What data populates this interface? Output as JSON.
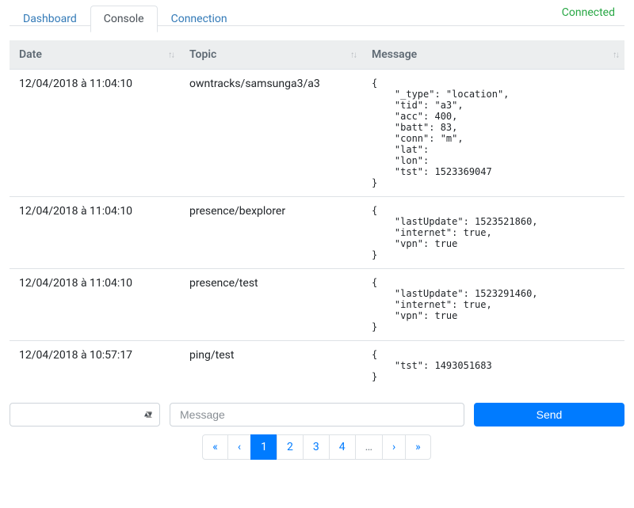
{
  "tabs": [
    {
      "label": "Dashboard",
      "active": false
    },
    {
      "label": "Console",
      "active": true
    },
    {
      "label": "Connection",
      "active": false
    }
  ],
  "status": "Connected",
  "columns": {
    "date": "Date",
    "topic": "Topic",
    "message": "Message"
  },
  "rows": [
    {
      "date": "12/04/2018 à 11:04:10",
      "topic": "owntracks/samsunga3/a3",
      "message": "{\n    \"_type\": \"location\",\n    \"tid\": \"a3\",\n    \"acc\": 400,\n    \"batt\": 83,\n    \"conn\": \"m\",\n    \"lat\":\n    \"lon\":\n    \"tst\": 1523369047\n}"
    },
    {
      "date": "12/04/2018 à 11:04:10",
      "topic": "presence/bexplorer",
      "message": "{\n    \"lastUpdate\": 1523521860,\n    \"internet\": true,\n    \"vpn\": true\n}"
    },
    {
      "date": "12/04/2018 à 11:04:10",
      "topic": "presence/test",
      "message": "{\n    \"lastUpdate\": 1523291460,\n    \"internet\": true,\n    \"vpn\": true\n}"
    },
    {
      "date": "12/04/2018 à 10:57:17",
      "topic": "ping/test",
      "message": "{\n    \"tst\": 1493051683\n}"
    }
  ],
  "message_input": {
    "placeholder": "Message"
  },
  "send_button": "Send",
  "pagination": [
    "«",
    "‹",
    "1",
    "2",
    "3",
    "4",
    "…",
    "›",
    "»"
  ],
  "pagination_active": "1"
}
